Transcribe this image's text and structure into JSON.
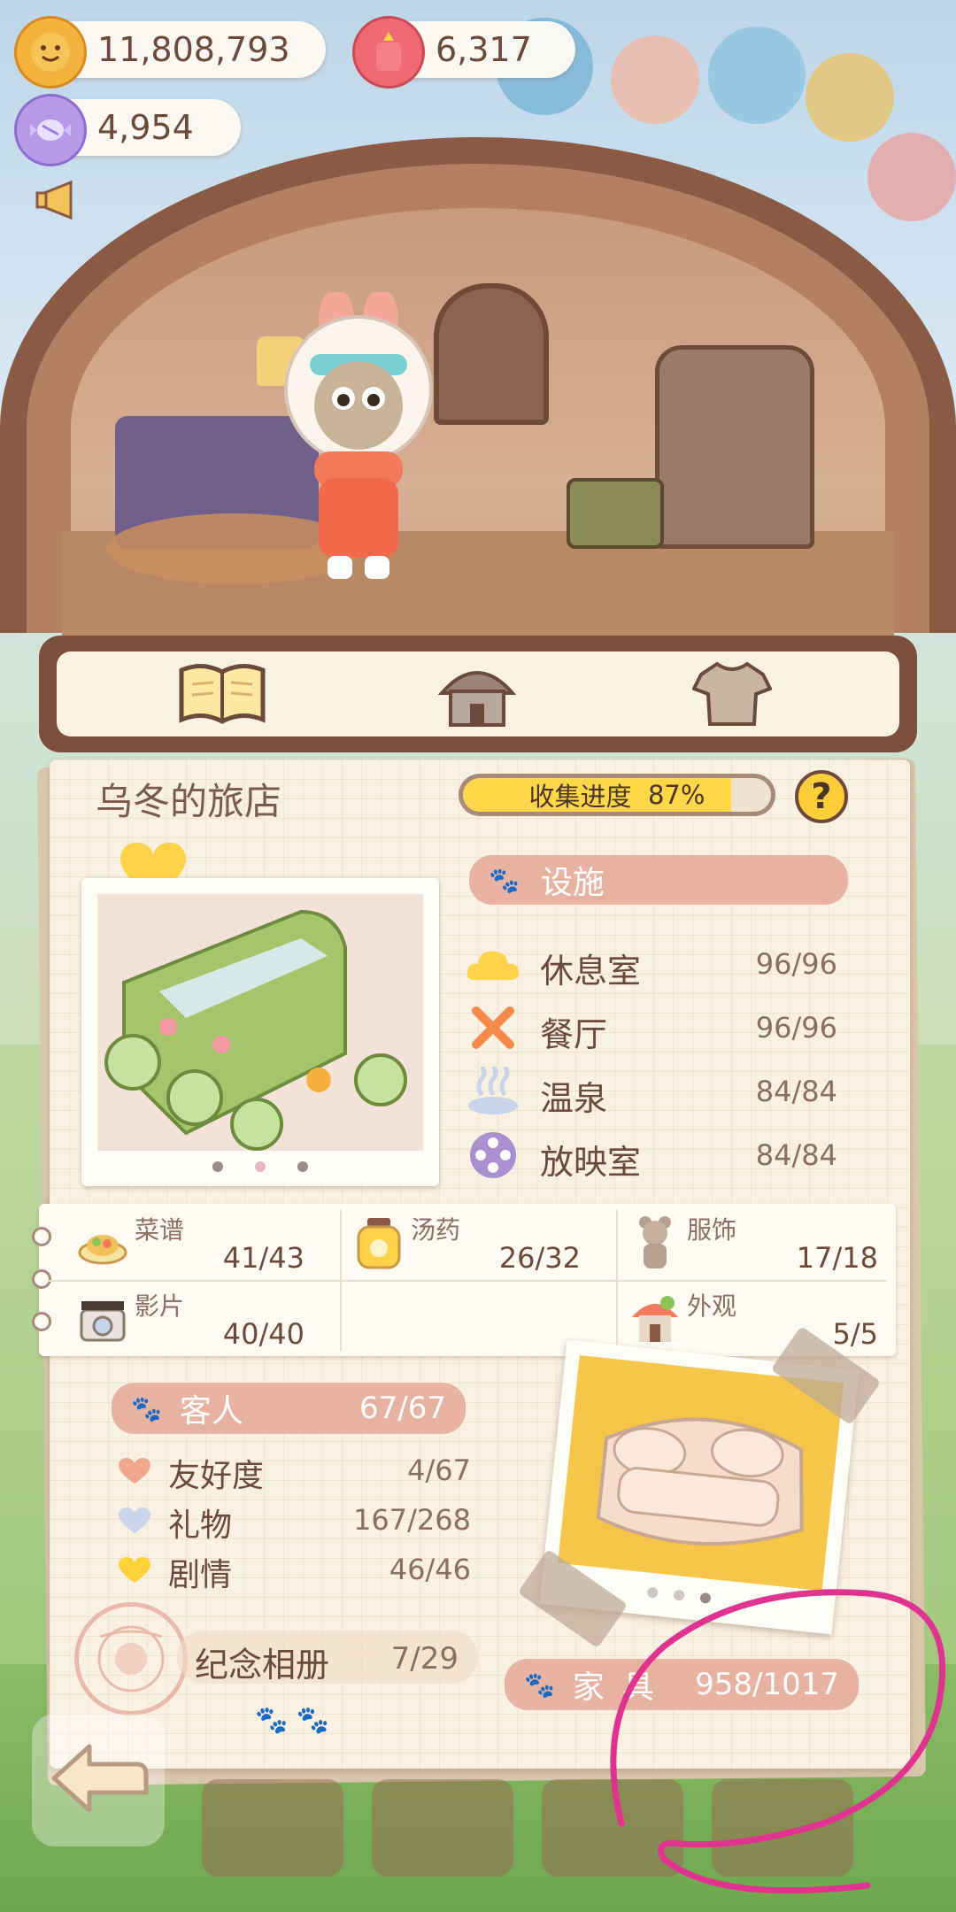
{
  "currencies": {
    "coins": "11,808,793",
    "gems": "6,317",
    "candy": "4,954"
  },
  "tabs": [
    {
      "icon": "open-book-icon"
    },
    {
      "icon": "hotel-building-icon"
    },
    {
      "icon": "tshirt-icon"
    }
  ],
  "inn": {
    "title": "乌冬的旅店",
    "progress_label": "收集进度",
    "progress_value": "87%",
    "progress_fraction": 0.87,
    "help": "?"
  },
  "facilities": {
    "header": "设施",
    "items": [
      {
        "name": "休息室",
        "value": "96/96",
        "icon": "cloud-icon"
      },
      {
        "name": "餐厅",
        "value": "96/96",
        "icon": "fork-knife-icon"
      },
      {
        "name": "温泉",
        "value": "84/84",
        "icon": "hot-spring-icon"
      },
      {
        "name": "放映室",
        "value": "84/84",
        "icon": "film-reel-icon"
      }
    ]
  },
  "collections": [
    {
      "name": "菜谱",
      "value": "41/43",
      "icon": "dish-icon"
    },
    {
      "name": "汤药",
      "value": "26/32",
      "icon": "potion-jar-icon"
    },
    {
      "name": "服饰",
      "value": "17/18",
      "icon": "doll-icon"
    },
    {
      "name": "影片",
      "value": "40/40",
      "icon": "film-camera-icon"
    },
    {
      "name": "外观",
      "value": "5/5",
      "icon": "hotel-building-icon"
    }
  ],
  "guests": {
    "header": "客人",
    "header_value": "67/67",
    "items": [
      {
        "name": "友好度",
        "value": "4/67",
        "color": "#f2a88f"
      },
      {
        "name": "礼物",
        "value": "167/268",
        "color": "#c9d3ea"
      },
      {
        "name": "剧情",
        "value": "46/46",
        "color": "#ffd23c"
      }
    ]
  },
  "album": {
    "name": "纪念相册",
    "value": "7/29"
  },
  "furniture": {
    "name": "家具",
    "value": "958/1017"
  },
  "colors": {
    "accent_ribbon": "#e8b3a0",
    "annotation": "#e0338f",
    "progress_fill": "#ffd84a"
  }
}
